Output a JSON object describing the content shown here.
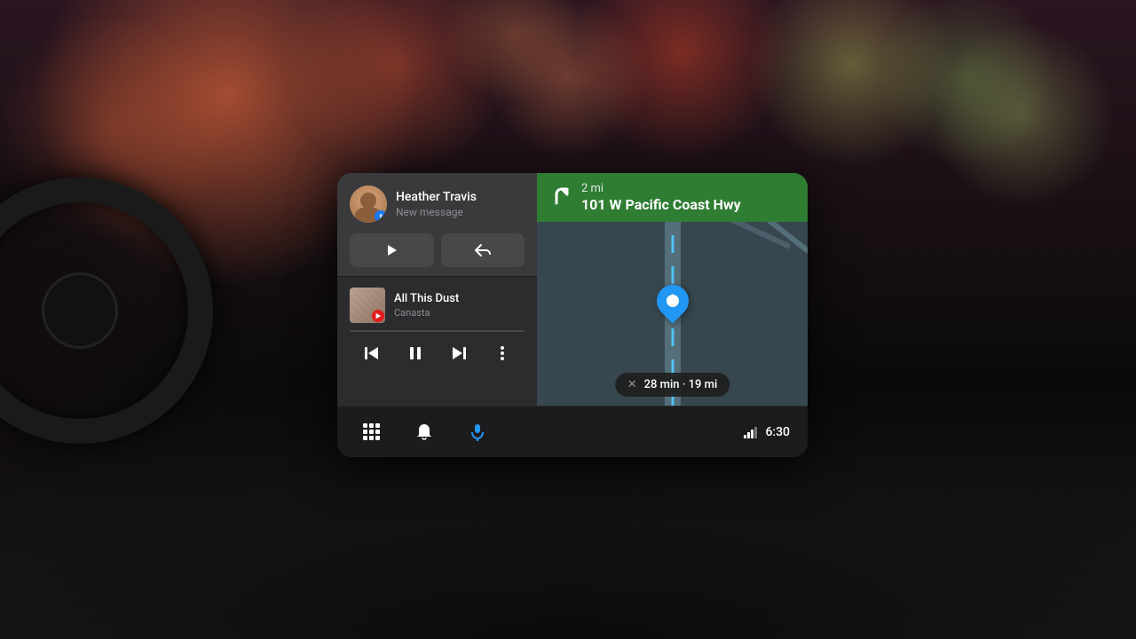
{
  "background": {
    "description": "Bokeh nighttime car interior background"
  },
  "screen": {
    "notification": {
      "sender_name": "Heather Travis",
      "subtitle": "New message",
      "play_label": "▶",
      "reply_label": "↩"
    },
    "music": {
      "title": "All This Dust",
      "artist": "Canasta",
      "album_art_alt": "Album art"
    },
    "music_controls": {
      "prev_label": "⏮",
      "pause_label": "⏸",
      "next_label": "⏭",
      "more_label": "⋮"
    },
    "navigation": {
      "distance": "2 mi",
      "street": "101 W Pacific Coast Hwy",
      "eta": "28 min · 19 mi",
      "turn_direction": "↰"
    },
    "bottom_bar": {
      "time": "6:30",
      "signal_icon": "signal"
    }
  }
}
